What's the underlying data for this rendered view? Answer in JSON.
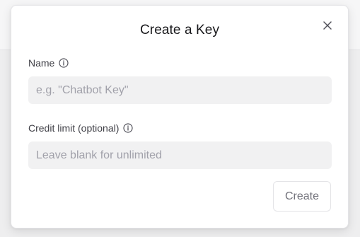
{
  "dialog": {
    "title": "Create a Key",
    "close_icon": "close-icon"
  },
  "fields": {
    "name": {
      "label": "Name",
      "info_icon": "info-icon",
      "value": "",
      "placeholder": "e.g. \"Chatbot Key\""
    },
    "credit_limit": {
      "label": "Credit limit (optional)",
      "info_icon": "info-icon",
      "value": "",
      "placeholder": "Leave blank for unlimited"
    }
  },
  "actions": {
    "create_label": "Create"
  },
  "colors": {
    "title": "#18181b",
    "label": "#3f3f46",
    "input_bg": "#f1f1f2",
    "placeholder": "#a1a1aa",
    "button_text": "#71717a",
    "border": "#e4e4e7"
  }
}
